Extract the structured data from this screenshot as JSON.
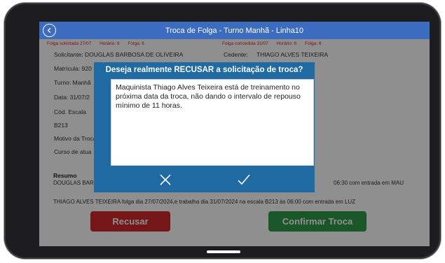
{
  "header": {
    "title": "Troca de Folga - Turno Manhã - Linha10",
    "back_icon": "back-arrow-icon"
  },
  "form": {
    "solicitante_red_label": "Folga solicitada 27/07",
    "solicitante_red_horario": "Horário: 6",
    "solicitante_red_folga": "Folga: 6",
    "cedente_red_label": "Folga concedida 31/07",
    "cedente_red_horario": "Horário: 6",
    "cedente_red_folga": "Folga: 6",
    "solicitante_label": "Solicitante:",
    "solicitante_value": "DOUGLAS BARBOSA DE OLIVEIRA",
    "cedente_label": "Cedente:",
    "cedente_value": "THIAGO ALVES TEIXEIRA",
    "matricula": "Matrícula: 920",
    "turno": "Turno: Manhã",
    "data": "Data: 31/07/2",
    "cod_escala_label": "Cód. Escala",
    "cod_escala_value": "B213",
    "motivo_label": "Motivo da Troca",
    "motivo_value": "Curso de atua",
    "resumo_title": "Resumo",
    "resumo_line1_start": "DOUGLAS BAR",
    "resumo_line1_end": "06:30 com entrada em MAU",
    "resumo_line2": "THIAGO ALVES TEIXEIRA folga dia 27/07/2024,e trabalha dia 31/07/2024 na escala B213 às 06:00 com entrada em LUZ"
  },
  "actions": {
    "reject_label": "Recusar",
    "confirm_label": "Confirmar Troca"
  },
  "modal": {
    "title": "Deseja realmente RECUSAR a solicitação de troca?",
    "reason_text": "Maquinista Thiago Alves Teixeira está de treinamento no próxima data da troca, não dando o intervalo de repouso mínimo de 11 horas.",
    "cancel_icon": "close-x-icon",
    "confirm_icon": "checkmark-icon"
  },
  "colors": {
    "header_bg": "#3b6cc0",
    "modal_bg": "#1f6aa3",
    "reject": "#d0282e",
    "confirm": "#2e9a48"
  }
}
